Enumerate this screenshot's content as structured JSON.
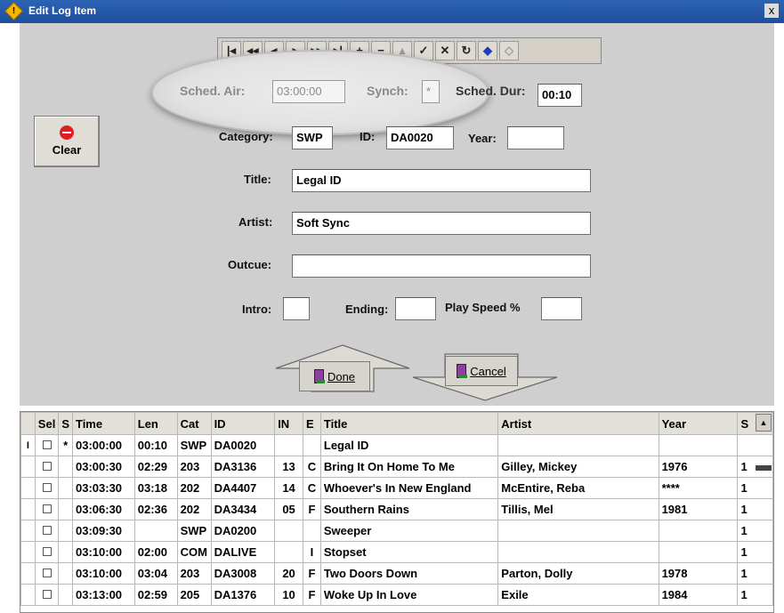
{
  "window": {
    "title": "Edit Log Item",
    "close_label": "x",
    "app_icon_glyph": "!"
  },
  "toolbar": {
    "buttons": [
      {
        "glyph": "|◂",
        "icon": "first-record-icon",
        "enabled": true
      },
      {
        "glyph": "◂◂",
        "icon": "rewind-icon",
        "enabled": true
      },
      {
        "glyph": "◂",
        "icon": "previous-icon",
        "enabled": true
      },
      {
        "glyph": "▸",
        "icon": "next-icon",
        "enabled": true
      },
      {
        "glyph": "▸▸",
        "icon": "fast-forward-icon",
        "enabled": true
      },
      {
        "glyph": "▸|",
        "icon": "last-record-icon",
        "enabled": true
      },
      {
        "glyph": "+",
        "icon": "add-icon",
        "enabled": true
      },
      {
        "glyph": "−",
        "icon": "delete-icon",
        "enabled": true
      },
      {
        "glyph": "▴",
        "icon": "edit-icon",
        "enabled": false
      },
      {
        "glyph": "✓",
        "icon": "post-icon",
        "enabled": true
      },
      {
        "glyph": "✕",
        "icon": "cancel-edit-icon",
        "enabled": true
      },
      {
        "glyph": "↻",
        "icon": "refresh-icon",
        "enabled": true
      },
      {
        "glyph": "◆",
        "icon": "save-tag-icon",
        "enabled": true
      },
      {
        "glyph": "◇",
        "icon": "clear-tag-icon",
        "enabled": false
      }
    ]
  },
  "form": {
    "sched_air": {
      "label": "Sched. Air:",
      "value": "03:00:00"
    },
    "synch": {
      "label": "Synch:",
      "value": "*"
    },
    "sched_dur": {
      "label": "Sched. Dur:",
      "value": "00:10"
    },
    "category": {
      "label": "Category:",
      "value": "SWP"
    },
    "id": {
      "label": "ID:",
      "value": "DA0020"
    },
    "year": {
      "label": "Year:",
      "value": ""
    },
    "title": {
      "label": "Title:",
      "value": "Legal ID"
    },
    "artist": {
      "label": "Artist:",
      "value": "Soft Sync"
    },
    "outcue": {
      "label": "Outcue:",
      "value": ""
    },
    "intro": {
      "label": "Intro:",
      "value": ""
    },
    "ending": {
      "label": "Ending:",
      "value": ""
    },
    "play_speed": {
      "label": "Play Speed %",
      "value": ""
    }
  },
  "buttons": {
    "clear": "Clear",
    "done": "Done",
    "cancel": "Cancel"
  },
  "grid": {
    "columns": [
      "Sel",
      "S",
      "Time",
      "Len",
      "Cat",
      "ID",
      "IN",
      "E",
      "Title",
      "Artist",
      "Year",
      "S"
    ],
    "rows": [
      {
        "marker": "I",
        "s": "*",
        "time": "03:00:00",
        "len": "00:10",
        "cat": "SWP",
        "id": "DA0020",
        "in": "",
        "e": "",
        "title": "Legal ID",
        "artist": "",
        "year": "",
        "last": ""
      },
      {
        "marker": "",
        "s": "",
        "time": "03:00:30",
        "len": "02:29",
        "cat": "203",
        "id": "DA3136",
        "in": "13",
        "e": "C",
        "title": "Bring It On Home To Me",
        "artist": "Gilley, Mickey",
        "year": "1976",
        "last": "1"
      },
      {
        "marker": "",
        "s": "",
        "time": "03:03:30",
        "len": "03:18",
        "cat": "202",
        "id": "DA4407",
        "in": "14",
        "e": "C",
        "title": "Whoever's In New England",
        "artist": "McEntire, Reba",
        "year": "****",
        "last": "1"
      },
      {
        "marker": "",
        "s": "",
        "time": "03:06:30",
        "len": "02:36",
        "cat": "202",
        "id": "DA3434",
        "in": "05",
        "e": "F",
        "title": "Southern Rains",
        "artist": "Tillis, Mel",
        "year": "1981",
        "last": "1"
      },
      {
        "marker": "",
        "s": "",
        "time": "03:09:30",
        "len": "",
        "cat": "SWP",
        "id": "DA0200",
        "in": "",
        "e": "",
        "title": "Sweeper",
        "artist": "",
        "year": "",
        "last": "1"
      },
      {
        "marker": "",
        "s": "",
        "time": "03:10:00",
        "len": "02:00",
        "cat": "COM",
        "id": "DALIVE",
        "in": "",
        "e": "I",
        "title": "Stopset",
        "artist": "",
        "year": "",
        "last": "1"
      },
      {
        "marker": "",
        "s": "",
        "time": "03:10:00",
        "len": "03:04",
        "cat": "203",
        "id": "DA3008",
        "in": "20",
        "e": "F",
        "title": "Two Doors Down",
        "artist": "Parton, Dolly",
        "year": "1978",
        "last": "1"
      },
      {
        "marker": "",
        "s": "",
        "time": "03:13:00",
        "len": "02:59",
        "cat": "205",
        "id": "DA1376",
        "in": "10",
        "e": "F",
        "title": "Woke Up In Love",
        "artist": "Exile",
        "year": "1984",
        "last": "1"
      }
    ]
  }
}
